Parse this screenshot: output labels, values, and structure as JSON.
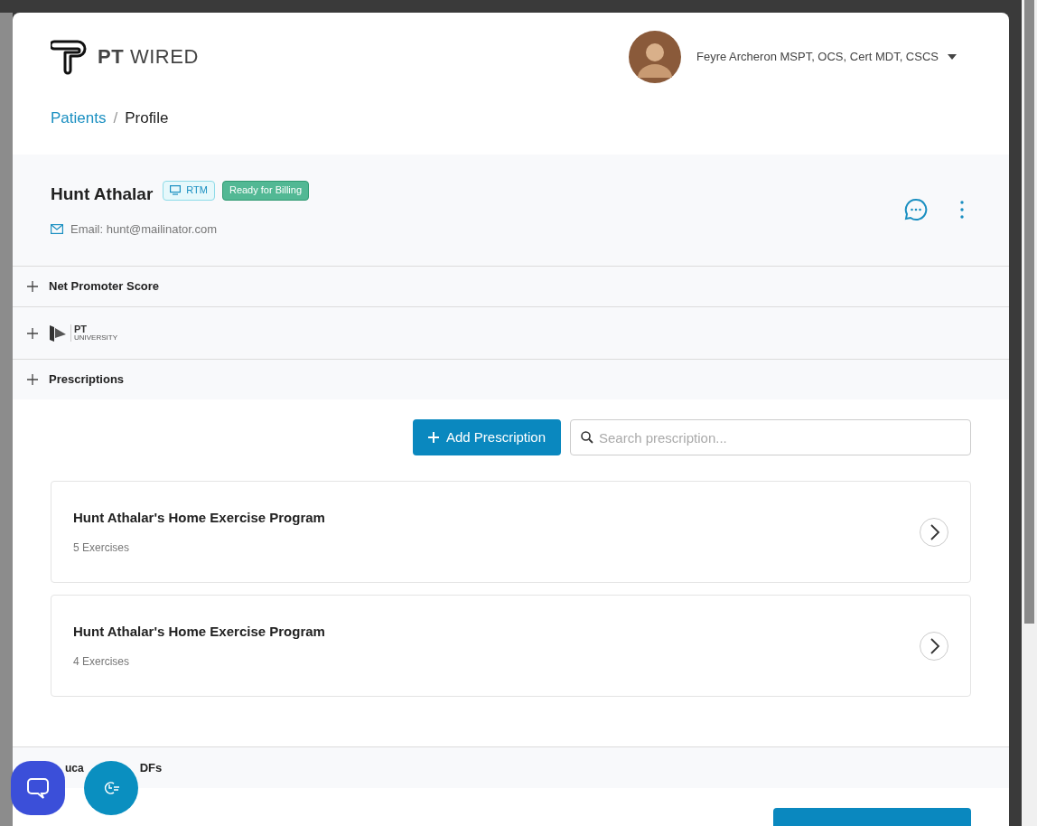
{
  "header": {
    "logo_text": "**PT** WIRED",
    "user": {
      "name": "Feyre Archeron MSPT, OCS, Cert MDT, CSCS"
    }
  },
  "breadcrumb": [
    {
      "label": "Patients",
      "kind": "link"
    },
    {
      "label": "/",
      "kind": "separator"
    },
    {
      "label": "Profile",
      "kind": "current"
    }
  ],
  "patient": {
    "name": "Hunt Athalar",
    "badges": [
      {
        "label": "RTM",
        "kind": "outline"
      },
      {
        "label": "Ready for Billing",
        "kind": "solid"
      }
    ],
    "email": "Email: hunt@mailinator.com"
  },
  "sections": [
    {
      "kind": "text",
      "label": "Net Promoter Score"
    },
    {
      "kind": "logo",
      "logo_top": "PT",
      "logo_bottom": "UNIVERSITY"
    },
    {
      "kind": "text",
      "label": "Prescriptions"
    }
  ],
  "prescriptions": {
    "add_button": "Add Prescription",
    "search": {
      "placeholder": "Search prescription..."
    },
    "items": [
      {
        "title": "Hunt Athalar's Home Exercise Program",
        "subtitle": "5 Exercises"
      },
      {
        "title": "Hunt Athalar's Home Exercise Program",
        "subtitle": "4 Exercises"
      }
    ]
  },
  "next_section": {
    "visible_parts": [
      "uca",
      "DFs"
    ]
  }
}
